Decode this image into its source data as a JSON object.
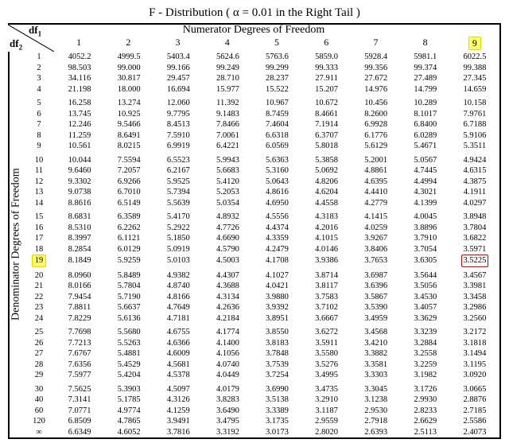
{
  "title_a": "F - Distribution ( ",
  "title_alpha": "α",
  "title_b": " = 0.01 in the Right Tail )",
  "num_label": "Numerator Degrees of Freedom",
  "den_label": "Denominator Degrees of Freedom",
  "df1_label": "df",
  "df1_sub": "1",
  "df2_label": "df",
  "df2_sub": "2",
  "col_headers": [
    "1",
    "2",
    "3",
    "4",
    "5",
    "6",
    "7",
    "8",
    "9"
  ],
  "highlight_col_index": 8,
  "highlight_row_index": 18,
  "highlight_cell": {
    "row_index": 18,
    "col_index": 8
  },
  "row_headers": [
    "1",
    "2",
    "3",
    "4",
    "5",
    "6",
    "7",
    "8",
    "9",
    "10",
    "11",
    "12",
    "13",
    "14",
    "15",
    "16",
    "17",
    "18",
    "19",
    "20",
    "21",
    "22",
    "23",
    "24",
    "25",
    "26",
    "27",
    "28",
    "29",
    "30",
    "40",
    "60",
    "120",
    "∞"
  ],
  "spacer_after": [
    3,
    8,
    13,
    18,
    23,
    28
  ],
  "chart_data": {
    "type": "table",
    "rows": [
      [
        "4052.2",
        "4999.5",
        "5403.4",
        "5624.6",
        "5763.6",
        "5859.0",
        "5928.4",
        "5981.1",
        "6022.5"
      ],
      [
        "98.503",
        "99.000",
        "99.166",
        "99.249",
        "99.299",
        "99.333",
        "99.356",
        "99.374",
        "99.388"
      ],
      [
        "34.116",
        "30.817",
        "29.457",
        "28.710",
        "28.237",
        "27.911",
        "27.672",
        "27.489",
        "27.345"
      ],
      [
        "21.198",
        "18.000",
        "16.694",
        "15.977",
        "15.522",
        "15.207",
        "14.976",
        "14.799",
        "14.659"
      ],
      [
        "16.258",
        "13.274",
        "12.060",
        "11.392",
        "10.967",
        "10.672",
        "10.456",
        "10.289",
        "10.158"
      ],
      [
        "13.745",
        "10.925",
        "9.7795",
        "9.1483",
        "8.7459",
        "8.4661",
        "8.2600",
        "8.1017",
        "7.9761"
      ],
      [
        "12.246",
        "9.5466",
        "8.4513",
        "7.8466",
        "7.4604",
        "7.1914",
        "6.9928",
        "6.8400",
        "6.7188"
      ],
      [
        "11.259",
        "8.6491",
        "7.5910",
        "7.0061",
        "6.6318",
        "6.3707",
        "6.1776",
        "6.0289",
        "5.9106"
      ],
      [
        "10.561",
        "8.0215",
        "6.9919",
        "6.4221",
        "6.0569",
        "5.8018",
        "5.6129",
        "5.4671",
        "5.3511"
      ],
      [
        "10.044",
        "7.5594",
        "6.5523",
        "5.9943",
        "5.6363",
        "5.3858",
        "5.2001",
        "5.0567",
        "4.9424"
      ],
      [
        "9.6460",
        "7.2057",
        "6.2167",
        "5.6683",
        "5.3160",
        "5.0692",
        "4.8861",
        "4.7445",
        "4.6315"
      ],
      [
        "9.3302",
        "6.9266",
        "5.9525",
        "5.4120",
        "5.0643",
        "4.8206",
        "4.6395",
        "4.4994",
        "4.3875"
      ],
      [
        "9.0738",
        "6.7010",
        "5.7394",
        "5.2053",
        "4.8616",
        "4.6204",
        "4.4410",
        "4.3021",
        "4.1911"
      ],
      [
        "8.8616",
        "6.5149",
        "5.5639",
        "5.0354",
        "4.6950",
        "4.4558",
        "4.2779",
        "4.1399",
        "4.0297"
      ],
      [
        "8.6831",
        "6.3589",
        "5.4170",
        "4.8932",
        "4.5556",
        "4.3183",
        "4.1415",
        "4.0045",
        "3.8948"
      ],
      [
        "8.5310",
        "6.2262",
        "5.2922",
        "4.7726",
        "4.4374",
        "4.2016",
        "4.0259",
        "3.8896",
        "3.7804"
      ],
      [
        "8.3997",
        "6.1121",
        "5.1850",
        "4.6690",
        "4.3359",
        "4.1015",
        "3.9267",
        "3.7910",
        "3.6822"
      ],
      [
        "8.2854",
        "6.0129",
        "5.0919",
        "4.5790",
        "4.2479",
        "4.0146",
        "3.8406",
        "3.7054",
        "3.5971"
      ],
      [
        "8.1849",
        "5.9259",
        "5.0103",
        "4.5003",
        "4.1708",
        "3.9386",
        "3.7653",
        "3.6305",
        "3.5225"
      ],
      [
        "8.0960",
        "5.8489",
        "4.9382",
        "4.4307",
        "4.1027",
        "3.8714",
        "3.6987",
        "3.5644",
        "3.4567"
      ],
      [
        "8.0166",
        "5.7804",
        "4.8740",
        "4.3688",
        "4.0421",
        "3.8117",
        "3.6396",
        "3.5056",
        "3.3981"
      ],
      [
        "7.9454",
        "5.7190",
        "4.8166",
        "4.3134",
        "3.9880",
        "3.7583",
        "3.5867",
        "3.4530",
        "3.3458"
      ],
      [
        "7.8811",
        "5.6637",
        "4.7649",
        "4.2636",
        "3.9392",
        "3.7102",
        "3.5390",
        "3.4057",
        "3.2986"
      ],
      [
        "7.8229",
        "5.6136",
        "4.7181",
        "4.2184",
        "3.8951",
        "3.6667",
        "3.4959",
        "3.3629",
        "3.2560"
      ],
      [
        "7.7698",
        "5.5680",
        "4.6755",
        "4.1774",
        "3.8550",
        "3.6272",
        "3.4568",
        "3.3239",
        "3.2172"
      ],
      [
        "7.7213",
        "5.5263",
        "4.6366",
        "4.1400",
        "3.8183",
        "3.5911",
        "3.4210",
        "3.2884",
        "3.1818"
      ],
      [
        "7.6767",
        "5.4881",
        "4.6009",
        "4.1056",
        "3.7848",
        "3.5580",
        "3.3882",
        "3.2558",
        "3.1494"
      ],
      [
        "7.6356",
        "5.4529",
        "4.5681",
        "4.0740",
        "3.7539",
        "3.5276",
        "3.3581",
        "3.2259",
        "3.1195"
      ],
      [
        "7.5977",
        "5.4204",
        "4.5378",
        "4.0449",
        "3.7254",
        "3.4995",
        "3.3303",
        "3.1982",
        "3.0920"
      ],
      [
        "7.5625",
        "5.3903",
        "4.5097",
        "4.0179",
        "3.6990",
        "3.4735",
        "3.3045",
        "3.1726",
        "3.0665"
      ],
      [
        "7.3141",
        "5.1785",
        "4.3126",
        "3.8283",
        "3.5138",
        "3.2910",
        "3.1238",
        "2.9930",
        "2.8876"
      ],
      [
        "7.0771",
        "4.9774",
        "4.1259",
        "3.6490",
        "3.3389",
        "3.1187",
        "2.9530",
        "2.8233",
        "2.7185"
      ],
      [
        "6.8509",
        "4.7865",
        "3.9491",
        "3.4795",
        "3.1735",
        "2.9559",
        "2.7918",
        "2.6629",
        "2.5586"
      ],
      [
        "6.6349",
        "4.6052",
        "3.7816",
        "3.3192",
        "3.0173",
        "2.8020",
        "2.6393",
        "2.5113",
        "2.4073"
      ]
    ]
  }
}
